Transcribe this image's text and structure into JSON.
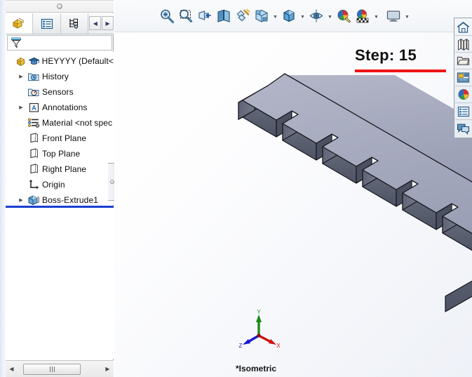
{
  "window": {
    "view_label": "*Isometric",
    "step_title": "Step: 15",
    "accent_red": "#f01414",
    "tree_highlight_blue": "#1a3fd0",
    "model_top_face_color": "#a8abc0",
    "model_side_face_color": "#5a5f70"
  },
  "feature_panel": {
    "splitter_grip": "splitter-grip-dot",
    "tabs": [
      {
        "name": "feature-manager-design-tree",
        "icon": "yellow-block-icon",
        "active": true
      },
      {
        "name": "property-manager",
        "icon": "property-list-icon",
        "active": false
      },
      {
        "name": "configuration-manager",
        "icon": "configuration-icon",
        "active": false
      }
    ],
    "nav_prev": "◀",
    "nav_next": "▶",
    "filter": {
      "icon": "filter-funnel-icon",
      "placeholder": "",
      "value": ""
    },
    "tree": [
      {
        "label": "HEYYYY  (Default<",
        "icon": "part-icon",
        "expander": "",
        "indent": 0
      },
      {
        "label": "History",
        "icon": "history-icon",
        "expander": "▶",
        "indent": 1
      },
      {
        "label": "Sensors",
        "icon": "sensors-icon",
        "expander": "",
        "indent": 1
      },
      {
        "label": "Annotations",
        "icon": "annotations-icon",
        "expander": "▶",
        "indent": 1
      },
      {
        "label": "Material <not spec",
        "icon": "material-icon",
        "expander": "",
        "indent": 1
      },
      {
        "label": "Front Plane",
        "icon": "plane-icon",
        "expander": "",
        "indent": 1
      },
      {
        "label": "Top Plane",
        "icon": "plane-icon",
        "expander": "",
        "indent": 1
      },
      {
        "label": "Right Plane",
        "icon": "plane-icon",
        "expander": "",
        "indent": 1
      },
      {
        "label": "Origin",
        "icon": "origin-icon",
        "expander": "",
        "indent": 1
      },
      {
        "label": "Boss-Extrude1",
        "icon": "boss-extrude-icon",
        "expander": "▶",
        "indent": 1
      }
    ],
    "scrollbar": {
      "left_arrow": "◀",
      "right_arrow": "▶"
    }
  },
  "view_toolbar": {
    "buttons": [
      {
        "name": "zoom-to-fit",
        "caret": false
      },
      {
        "name": "zoom-to-area",
        "caret": false
      },
      {
        "name": "zoom-in-out",
        "caret": false
      },
      {
        "name": "section-view",
        "caret": false
      },
      {
        "name": "view-orientation-wizard",
        "caret": false
      },
      {
        "name": "view-orientation",
        "caret": true
      },
      {
        "name": "display-style",
        "caret": true
      },
      {
        "name": "hide-show-items",
        "caret": true
      },
      {
        "name": "edit-appearance",
        "caret": false
      },
      {
        "name": "apply-scene",
        "caret": true
      },
      {
        "name": "view-settings",
        "caret": true
      }
    ]
  },
  "task_pane": {
    "buttons": [
      {
        "name": "solidworks-resources",
        "icon": "home-icon"
      },
      {
        "name": "design-library",
        "icon": "library-books-icon"
      },
      {
        "name": "file-explorer",
        "icon": "folder-icon"
      },
      {
        "name": "view-palette",
        "icon": "view-palette-icon"
      },
      {
        "name": "appearances-scenes",
        "icon": "appearances-sphere-icon"
      },
      {
        "name": "custom-properties",
        "icon": "custom-properties-icon"
      },
      {
        "name": "solidworks-forum",
        "icon": "forum-chat-icon"
      }
    ]
  },
  "triad": {
    "axis_y": {
      "label": "Y",
      "color": "#1a8a1a"
    },
    "axis_x": {
      "label": "X",
      "color": "#d01010"
    },
    "axis_z": {
      "label": "Z",
      "color": "#1a1ad0"
    }
  },
  "model": {
    "description": "isometric extruded comb/rack part with seven teeth",
    "teeth_count": 7
  }
}
